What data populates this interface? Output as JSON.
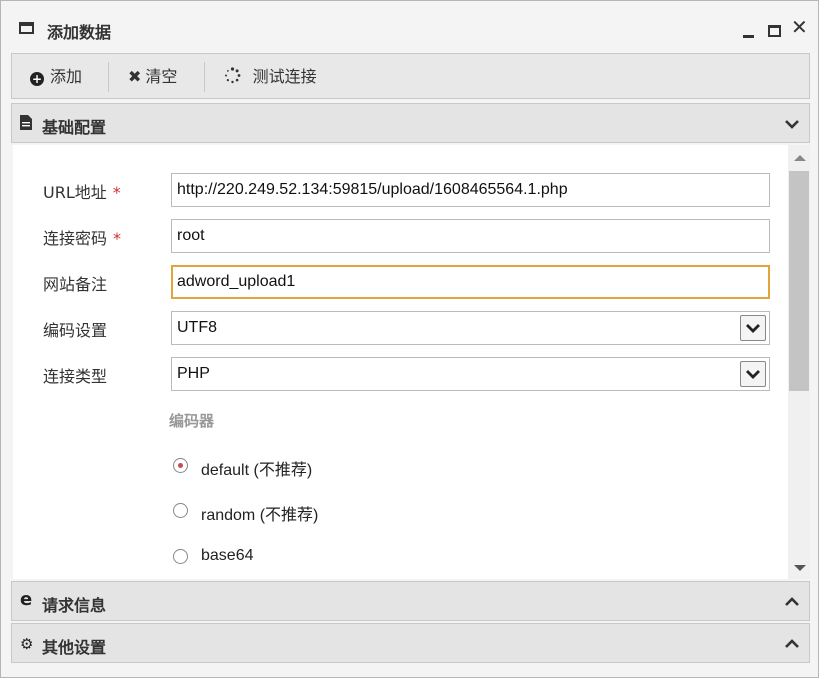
{
  "window": {
    "title": "添加数据"
  },
  "toolbar": {
    "add_label": "添加",
    "clear_label": "清空",
    "test_label": "测试连接"
  },
  "sections": {
    "basic": {
      "title": "基础配置"
    },
    "request": {
      "title": "请求信息"
    },
    "other": {
      "title": "其他设置"
    }
  },
  "form": {
    "url_label": "URL地址",
    "url_value": "http://220.249.52.134:59815/upload/1608465564.1.php",
    "password_label": "连接密码",
    "password_value": "root",
    "note_label": "网站备注",
    "note_value": "adword_upload1",
    "encoding_label": "编码设置",
    "encoding_value": "UTF8",
    "type_label": "连接类型",
    "type_value": "PHP",
    "required_mark": "*",
    "encoder_title": "编码器",
    "encoders": [
      {
        "label": "default (不推荐)",
        "selected": true
      },
      {
        "label": "random (不推荐)",
        "selected": false
      },
      {
        "label": "base64",
        "selected": false
      }
    ]
  },
  "colors": {
    "accent_focus": "#e0a53c",
    "required": "#d0302f",
    "radio_dot": "#c0504d"
  }
}
